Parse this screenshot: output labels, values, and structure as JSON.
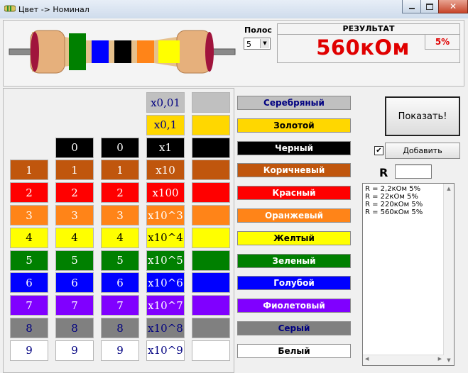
{
  "window": {
    "title": "Цвет -> Номинал"
  },
  "colors": {
    "silver": "#c0c0c0",
    "gold": "#ffd700",
    "black": "#000000",
    "brown": "#c0560d",
    "red": "#ff0000",
    "orange": "#ff8418",
    "yellow": "#ffff00",
    "green": "#008000",
    "blue": "#0000ff",
    "violet": "#8000ff",
    "gray": "#808080",
    "white": "#ffffff",
    "result_text": "#e00000",
    "body": "#e6c08c"
  },
  "bands_control": {
    "label": "Полос",
    "value": "5"
  },
  "result": {
    "header": "РЕЗУЛЬТАТ",
    "value": "560кОм",
    "tolerance": "5%"
  },
  "resistor_bands": [
    "green",
    "blue",
    "black",
    "orange",
    "yellow"
  ],
  "columns": {
    "digit1": [
      "",
      "",
      "",
      "1",
      "2",
      "3",
      "4",
      "5",
      "6",
      "7",
      "8",
      "9"
    ],
    "digit2": [
      "",
      "",
      "0",
      "1",
      "2",
      "3",
      "4",
      "5",
      "6",
      "7",
      "8",
      "9"
    ],
    "digit3": [
      "",
      "",
      "0",
      "1",
      "2",
      "3",
      "4",
      "5",
      "6",
      "7",
      "8",
      "9"
    ],
    "multiplier": [
      "x0,01",
      "x0,1",
      "x1",
      "x10",
      "x100",
      "x10^3",
      "x10^4",
      "x10^5",
      "x10^6",
      "x10^7",
      "x10^8",
      "x10^9"
    ]
  },
  "color_list": [
    {
      "label": "Серебряный",
      "key": "silver"
    },
    {
      "label": "Золотой",
      "key": "gold"
    },
    {
      "label": "Черный",
      "key": "black"
    },
    {
      "label": "Коричневый",
      "key": "brown"
    },
    {
      "label": "Красный",
      "key": "red"
    },
    {
      "label": "Оранжевый",
      "key": "orange"
    },
    {
      "label": "Желтый",
      "key": "yellow"
    },
    {
      "label": "Зеленый",
      "key": "green"
    },
    {
      "label": "Голубой",
      "key": "blue"
    },
    {
      "label": "Фиолетовый",
      "key": "violet"
    },
    {
      "label": "Серый",
      "key": "gray"
    },
    {
      "label": "Белый",
      "key": "white"
    }
  ],
  "controls": {
    "show_button": "Показать!",
    "add_checkbox": {
      "label": "Добавить",
      "checked": true
    },
    "r_label": "R",
    "r_input": ""
  },
  "history": [
    "R = 2,2кОм  5%",
    "R = 22кОм  5%",
    "R = 220кОм  5%",
    "R = 560кОм  5%"
  ]
}
